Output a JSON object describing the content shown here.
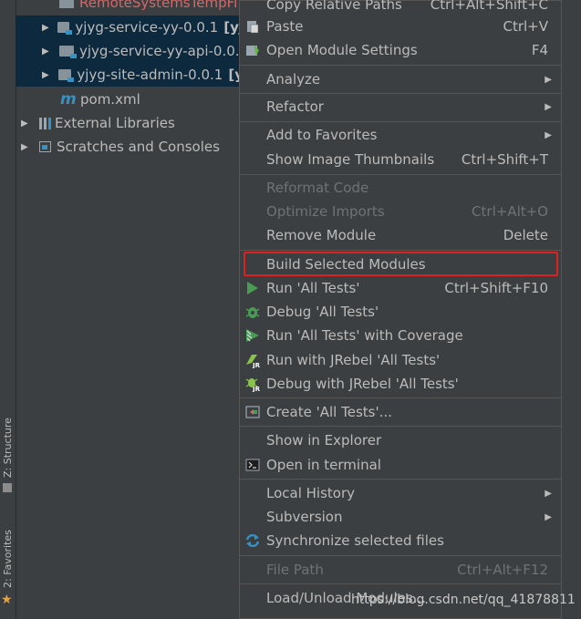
{
  "sidebar": {
    "structure_tab": "Z: Structure",
    "favorites_tab": "2: Favorites"
  },
  "tree": {
    "items": [
      {
        "label": "RemoteSystemsTempFi",
        "type": "folder",
        "color": "#d16969"
      },
      {
        "label": "yjyg-service-yy-0.0.1",
        "suffix": "[yj",
        "type": "module"
      },
      {
        "label": "yjyg-service-yy-api-0.0.",
        "suffix": "",
        "type": "module"
      },
      {
        "label": "yjyg-site-admin-0.0.1",
        "suffix": "[y",
        "type": "module"
      },
      {
        "label": "pom.xml",
        "type": "maven"
      },
      {
        "label": "External Libraries",
        "type": "libraries"
      },
      {
        "label": "Scratches and Consoles",
        "type": "scratches"
      }
    ]
  },
  "menu": {
    "items": [
      {
        "label": "Copy Relative Paths",
        "shortcut": "Ctrl+Alt+Shift+C"
      },
      {
        "label": "Paste",
        "shortcut": "Ctrl+V",
        "icon": "paste-icon"
      },
      {
        "label": "Open Module Settings",
        "shortcut": "F4",
        "icon": "module-settings-icon"
      },
      {
        "label": "Analyze",
        "submenu": true
      },
      {
        "label": "Refactor",
        "submenu": true
      },
      {
        "label": "Add to Favorites",
        "submenu": true
      },
      {
        "label": "Show Image Thumbnails",
        "shortcut": "Ctrl+Shift+T"
      },
      {
        "label": "Reformat Code",
        "disabled": true
      },
      {
        "label": "Optimize Imports",
        "shortcut": "Ctrl+Alt+O",
        "disabled": true
      },
      {
        "label": "Remove Module",
        "shortcut": "Delete"
      },
      {
        "label": "Build Selected Modules"
      },
      {
        "label": "Run 'All Tests'",
        "shortcut": "Ctrl+Shift+F10",
        "icon": "run-icon"
      },
      {
        "label": "Debug 'All Tests'",
        "icon": "debug-icon"
      },
      {
        "label": "Run 'All Tests' with Coverage",
        "icon": "coverage-icon"
      },
      {
        "label": "Run with JRebel 'All Tests'",
        "icon": "jrebel-run-icon"
      },
      {
        "label": "Debug with JRebel 'All Tests'",
        "icon": "jrebel-debug-icon"
      },
      {
        "label": "Create 'All Tests'...",
        "icon": "create-test-icon"
      },
      {
        "label": "Show in Explorer"
      },
      {
        "label": "Open in terminal",
        "icon": "terminal-icon"
      },
      {
        "label": "Local History",
        "submenu": true
      },
      {
        "label": "Subversion",
        "submenu": true
      },
      {
        "label": "Synchronize selected files",
        "icon": "sync-icon"
      },
      {
        "label": "File Path",
        "shortcut": "Ctrl+Alt+F12",
        "disabled": true
      },
      {
        "label": "Load/Unload Modules..."
      }
    ]
  },
  "watermark": "https://blog.csdn.net/qq_41878811",
  "colors": {
    "background": "#3c3f41",
    "selection": "#0d293e",
    "highlight_box": "#e0201f",
    "run_green": "#499c54"
  }
}
